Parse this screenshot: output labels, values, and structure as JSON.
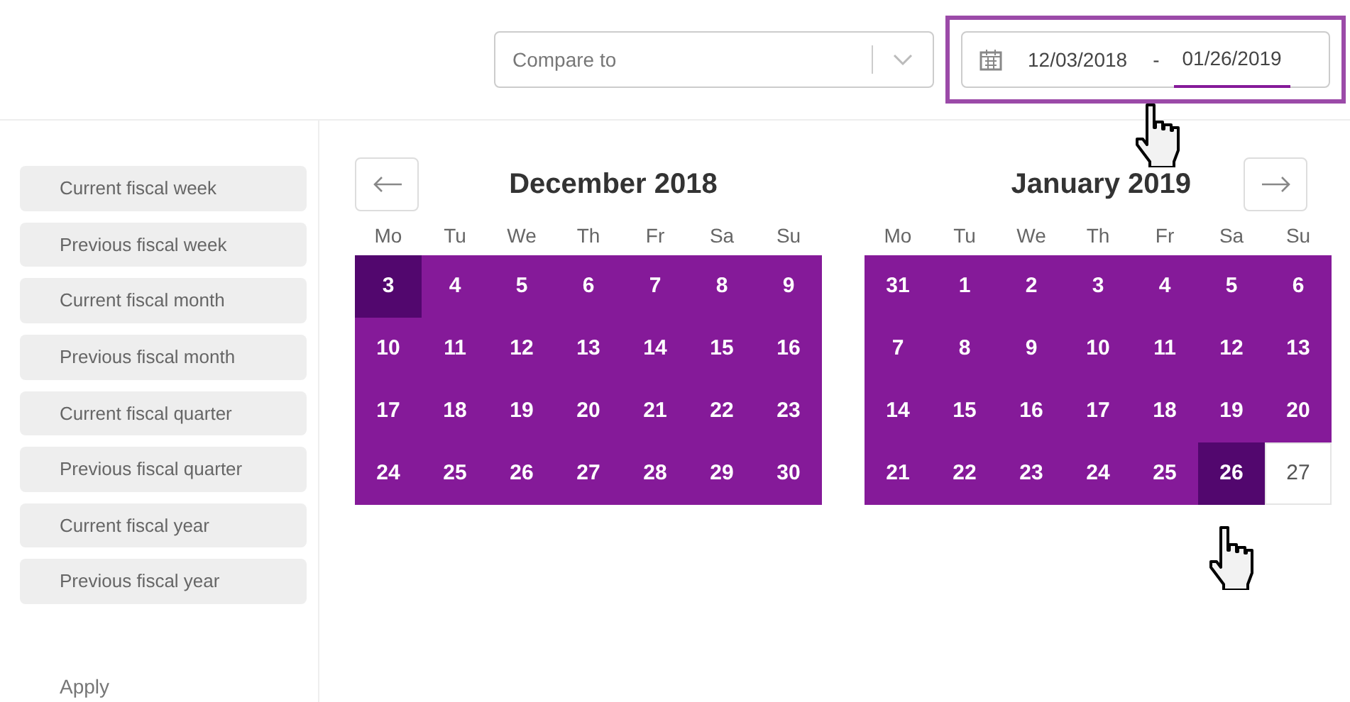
{
  "compare": {
    "placeholder": "Compare to"
  },
  "date_range": {
    "start": "12/03/2018",
    "separator": "-",
    "end": "01/26/2019",
    "end_focused": true,
    "highlighted": true
  },
  "presets": [
    {
      "label": "Current fiscal week"
    },
    {
      "label": "Previous fiscal week"
    },
    {
      "label": "Current fiscal month"
    },
    {
      "label": "Previous fiscal month"
    },
    {
      "label": "Current fiscal quarter"
    },
    {
      "label": "Previous fiscal quarter"
    },
    {
      "label": "Current fiscal year"
    },
    {
      "label": "Previous fiscal year"
    }
  ],
  "apply": "Apply",
  "calendars": [
    {
      "title": "December 2018",
      "weekdays": [
        "Mo",
        "Tu",
        "We",
        "Th",
        "Fr",
        "Sa",
        "Su"
      ],
      "days": [
        {
          "label": "3",
          "selected": true,
          "in_range": true
        },
        {
          "label": "4",
          "selected": false,
          "in_range": true
        },
        {
          "label": "5",
          "selected": false,
          "in_range": true
        },
        {
          "label": "6",
          "selected": false,
          "in_range": true
        },
        {
          "label": "7",
          "selected": false,
          "in_range": true
        },
        {
          "label": "8",
          "selected": false,
          "in_range": true
        },
        {
          "label": "9",
          "selected": false,
          "in_range": true
        },
        {
          "label": "10",
          "selected": false,
          "in_range": true
        },
        {
          "label": "11",
          "selected": false,
          "in_range": true
        },
        {
          "label": "12",
          "selected": false,
          "in_range": true
        },
        {
          "label": "13",
          "selected": false,
          "in_range": true
        },
        {
          "label": "14",
          "selected": false,
          "in_range": true
        },
        {
          "label": "15",
          "selected": false,
          "in_range": true
        },
        {
          "label": "16",
          "selected": false,
          "in_range": true
        },
        {
          "label": "17",
          "selected": false,
          "in_range": true
        },
        {
          "label": "18",
          "selected": false,
          "in_range": true
        },
        {
          "label": "19",
          "selected": false,
          "in_range": true
        },
        {
          "label": "20",
          "selected": false,
          "in_range": true
        },
        {
          "label": "21",
          "selected": false,
          "in_range": true
        },
        {
          "label": "22",
          "selected": false,
          "in_range": true
        },
        {
          "label": "23",
          "selected": false,
          "in_range": true
        },
        {
          "label": "24",
          "selected": false,
          "in_range": true
        },
        {
          "label": "25",
          "selected": false,
          "in_range": true
        },
        {
          "label": "26",
          "selected": false,
          "in_range": true
        },
        {
          "label": "27",
          "selected": false,
          "in_range": true
        },
        {
          "label": "28",
          "selected": false,
          "in_range": true
        },
        {
          "label": "29",
          "selected": false,
          "in_range": true
        },
        {
          "label": "30",
          "selected": false,
          "in_range": true
        }
      ]
    },
    {
      "title": "January 2019",
      "weekdays": [
        "Mo",
        "Tu",
        "We",
        "Th",
        "Fr",
        "Sa",
        "Su"
      ],
      "days": [
        {
          "label": "31",
          "selected": false,
          "in_range": true
        },
        {
          "label": "1",
          "selected": false,
          "in_range": true
        },
        {
          "label": "2",
          "selected": false,
          "in_range": true
        },
        {
          "label": "3",
          "selected": false,
          "in_range": true
        },
        {
          "label": "4",
          "selected": false,
          "in_range": true
        },
        {
          "label": "5",
          "selected": false,
          "in_range": true
        },
        {
          "label": "6",
          "selected": false,
          "in_range": true
        },
        {
          "label": "7",
          "selected": false,
          "in_range": true
        },
        {
          "label": "8",
          "selected": false,
          "in_range": true
        },
        {
          "label": "9",
          "selected": false,
          "in_range": true
        },
        {
          "label": "10",
          "selected": false,
          "in_range": true
        },
        {
          "label": "11",
          "selected": false,
          "in_range": true
        },
        {
          "label": "12",
          "selected": false,
          "in_range": true
        },
        {
          "label": "13",
          "selected": false,
          "in_range": true
        },
        {
          "label": "14",
          "selected": false,
          "in_range": true
        },
        {
          "label": "15",
          "selected": false,
          "in_range": true
        },
        {
          "label": "16",
          "selected": false,
          "in_range": true
        },
        {
          "label": "17",
          "selected": false,
          "in_range": true
        },
        {
          "label": "18",
          "selected": false,
          "in_range": true
        },
        {
          "label": "19",
          "selected": false,
          "in_range": true
        },
        {
          "label": "20",
          "selected": false,
          "in_range": true
        },
        {
          "label": "21",
          "selected": false,
          "in_range": true
        },
        {
          "label": "22",
          "selected": false,
          "in_range": true
        },
        {
          "label": "23",
          "selected": false,
          "in_range": true
        },
        {
          "label": "24",
          "selected": false,
          "in_range": true
        },
        {
          "label": "25",
          "selected": false,
          "in_range": true
        },
        {
          "label": "26",
          "selected": true,
          "in_range": true
        },
        {
          "label": "27",
          "selected": false,
          "in_range": false
        }
      ]
    }
  ]
}
